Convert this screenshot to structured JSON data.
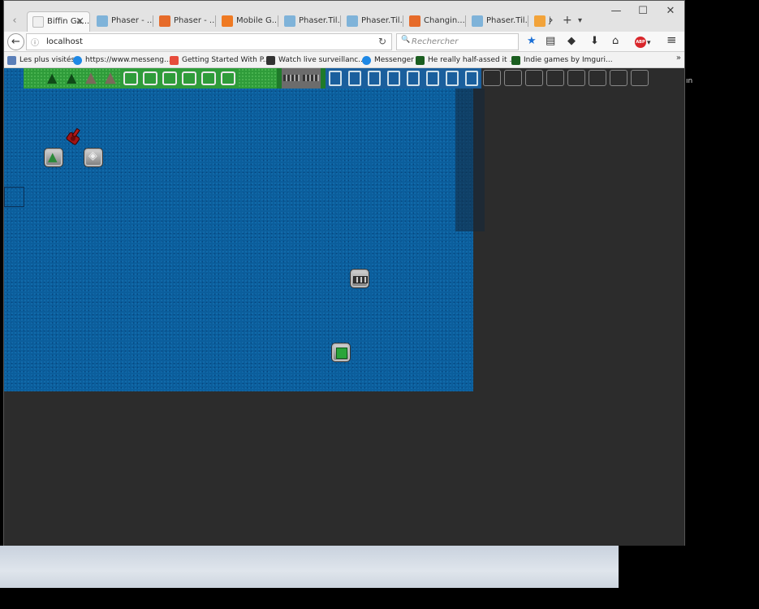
{
  "tabs": [
    {
      "label": "Biffin Ga...",
      "active": true,
      "icon_color": "#ffffff"
    },
    {
      "label": "Phaser - ...",
      "icon_color": "#7fb3d9"
    },
    {
      "label": "Phaser - ...",
      "icon_color": "#e66b2a"
    },
    {
      "label": "Mobile G...",
      "icon_color": "#ef7a23"
    },
    {
      "label": "Phaser.Til...",
      "icon_color": "#7fb3d9"
    },
    {
      "label": "Phaser.Til...",
      "icon_color": "#7fb3d9"
    },
    {
      "label": "Changin...",
      "icon_color": "#e66b2a"
    },
    {
      "label": "Phaser.Til...",
      "icon_color": "#7fb3d9"
    },
    {
      "label": "j",
      "icon_color": "#f2a33a"
    }
  ],
  "tab_strip": {
    "new_tab_symbol": "+",
    "list_tabs_symbol": "▾",
    "scroll_right_symbol": "›",
    "back_symbol": "‹",
    "close_symbol": "×"
  },
  "window": {
    "minimize": "—",
    "maximize": "☐",
    "close": "✕"
  },
  "nav": {
    "back_symbol": "←",
    "info_symbol": "ⓘ",
    "url": "localhost",
    "reload_symbol": "↻",
    "search_symbol": "🔍",
    "search_placeholder": "Rechercher",
    "bookmark_star": "★",
    "reading_list": "▤",
    "pocket": "◆",
    "download": "⬇",
    "home": "⌂",
    "adblock": "ABP",
    "adblock_menu": "▾",
    "menu": "≡"
  },
  "bookmarks": [
    {
      "label": "Les plus visités",
      "icon_color": "#5a7fb8"
    },
    {
      "label": "https://www.messeng...",
      "icon_color": "#1e88e5"
    },
    {
      "label": "Getting Started With P...",
      "icon_color": "#e74c3c"
    },
    {
      "label": "Watch live surveillanc...",
      "icon_color": "#333333"
    },
    {
      "label": "Messenger",
      "icon_color": "#1e88e5"
    },
    {
      "label": "He really half-assed it ...",
      "icon_color": "#1b5e20"
    },
    {
      "label": "Indie games by Imguri...",
      "icon_color": "#1b5e20"
    }
  ],
  "bookmarks_more": "»",
  "edge_text": "ın",
  "colors": {
    "water": "#0b5e9c",
    "grass": "#2f9c3a",
    "page_background": "#2c2c2c"
  }
}
